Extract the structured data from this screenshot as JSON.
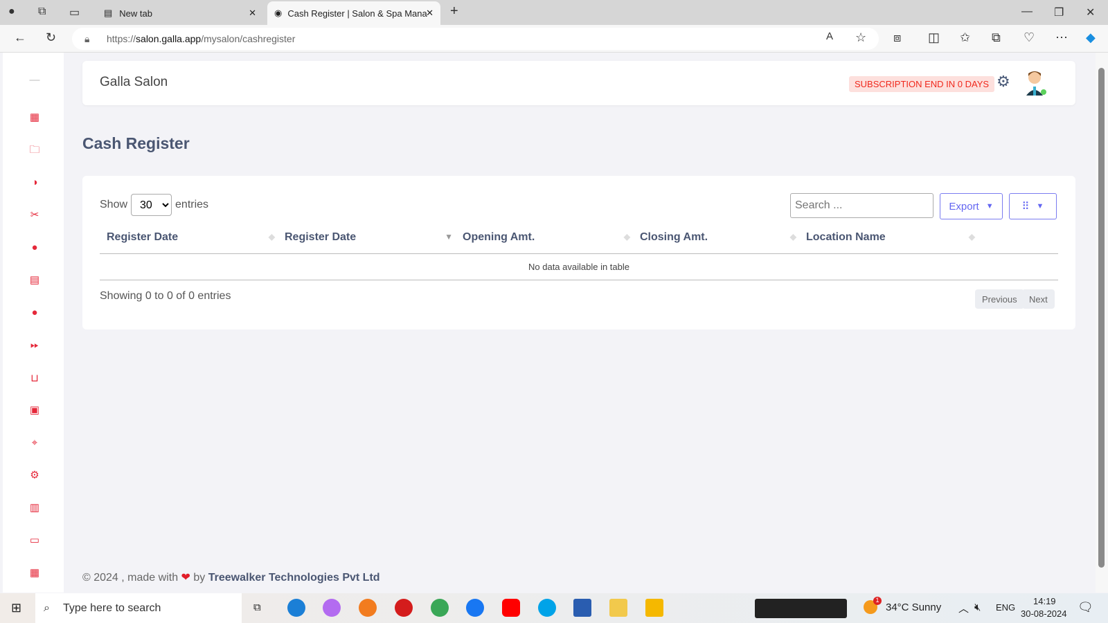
{
  "browser": {
    "tabs": [
      {
        "label": "New tab"
      },
      {
        "label": "Cash Register | Salon & Spa Mana"
      }
    ],
    "url_prefix": "https://",
    "url_host": "salon.galla.app",
    "url_path": "/mysalon/cashregister"
  },
  "header": {
    "brand": "Galla Salon",
    "subscription_badge": "SUBSCRIPTION END IN 0 DAYS"
  },
  "page": {
    "title": "Cash Register"
  },
  "table": {
    "show_label": "Show",
    "entries_label": "entries",
    "page_size": "30",
    "search_placeholder": "Search ...",
    "export_label": "Export",
    "columns": [
      "Register Date",
      "Register Date",
      "Opening Amt.",
      "Closing Amt.",
      "Location Name"
    ],
    "empty_message": "No data available in table",
    "info": "Showing 0 to 0 of 0 entries",
    "previous": "Previous",
    "next": "Next"
  },
  "footer": {
    "prefix": "© 2024 , made with",
    "by": "by",
    "company": "Treewalker Technologies Pvt Ltd"
  },
  "taskbar": {
    "search_placeholder": "Type here to search",
    "weather": "34°C  Sunny",
    "lang": "ENG",
    "time": "14:19",
    "date": "30-08-2024",
    "weather_badge": "1"
  },
  "colors": {
    "accent": "#6366f1",
    "sidebar_icon": "#e5283a",
    "badge_text": "#f0281c"
  }
}
